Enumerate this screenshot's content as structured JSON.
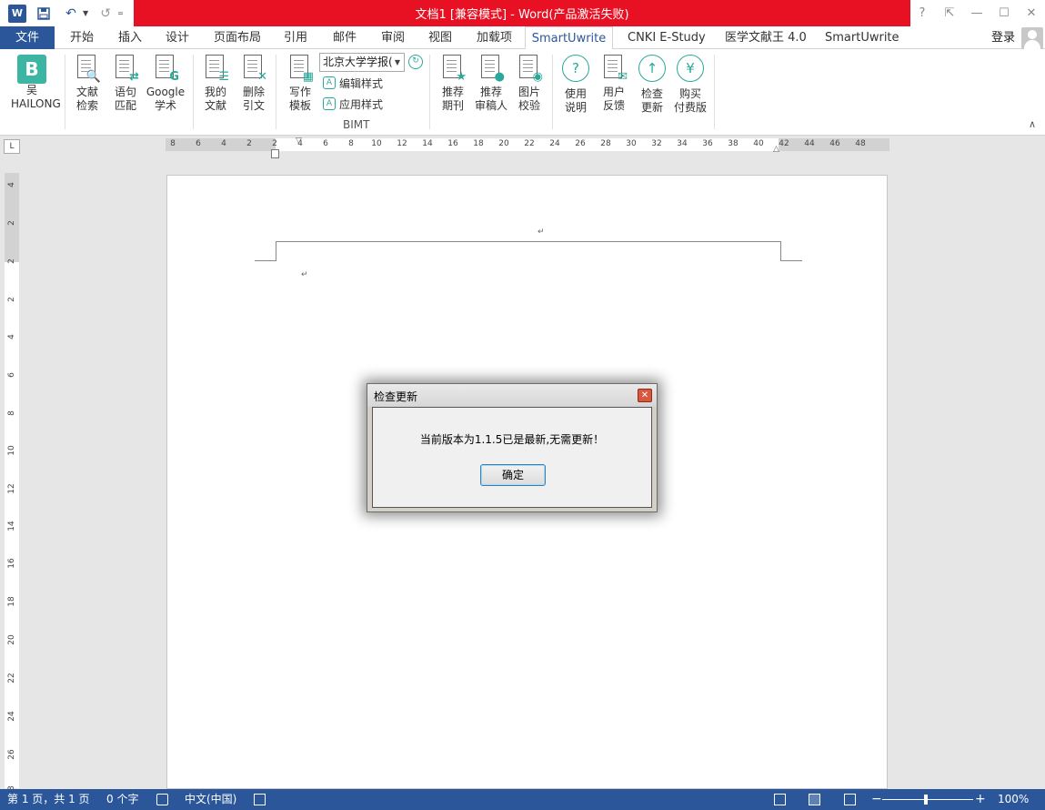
{
  "titlebar": {
    "title": "文档1 [兼容模式] - Word(产品激活失败)",
    "word_icon": "W",
    "undo_icon": "↶",
    "redo_icon": "↺",
    "customize_icon": "=",
    "help": "?",
    "restore_ribbon": "⇱",
    "minimize": "—",
    "maximize": "☐",
    "close": "✕"
  },
  "tabs": {
    "file": "文件",
    "items": [
      "开始",
      "插入",
      "设计",
      "页面布局",
      "引用",
      "邮件",
      "审阅",
      "视图",
      "加载项",
      "SmartUwrite",
      "CNKI E-Study",
      "医学文献王 4.0",
      "SmartUwrite"
    ],
    "active_index": 9,
    "login": "登录"
  },
  "ribbon": {
    "user_btn": {
      "icon_letter": "B",
      "line1": "吴",
      "line2": "HAILONG"
    },
    "buttons": [
      {
        "line1": "文献",
        "line2": "检索",
        "badge": "🔍"
      },
      {
        "line1": "语句",
        "line2": "匹配",
        "badge": "⇄"
      },
      {
        "line1": "Google",
        "line2": "学术",
        "badge": "G"
      },
      {
        "line1": "我的",
        "line2": "文献",
        "badge": "☰"
      },
      {
        "line1": "删除",
        "line2": "引文",
        "badge": "✕"
      },
      {
        "line1": "写作",
        "line2": "模板",
        "badge": "▦"
      }
    ],
    "style_select": "北京大学学报(",
    "edit_style": "编辑样式",
    "apply_style": "应用样式",
    "group_label": "BIMT",
    "right_buttons": [
      {
        "line1": "推荐",
        "line2": "期刊",
        "badge": "★"
      },
      {
        "line1": "推荐",
        "line2": "审稿人",
        "badge": "●"
      },
      {
        "line1": "图片",
        "line2": "校验",
        "badge": "◉"
      }
    ],
    "circle_buttons": [
      {
        "line1": "使用",
        "line2": "说明",
        "glyph": "?"
      },
      {
        "line1": "用户",
        "line2": "反馈",
        "glyph": "✉"
      },
      {
        "line1": "检查",
        "line2": "更新",
        "glyph": "↑"
      },
      {
        "line1": "购买",
        "line2": "付费版",
        "glyph": "¥"
      }
    ],
    "collapse": "∧"
  },
  "ruler": {
    "corner": "L",
    "h_ticks": [
      "8",
      "6",
      "4",
      "2",
      "2",
      "4",
      "6",
      "8",
      "10",
      "12",
      "14",
      "16",
      "18",
      "20",
      "22",
      "24",
      "26",
      "28",
      "30",
      "32",
      "34",
      "36",
      "38",
      "40",
      "42",
      "44",
      "46",
      "48"
    ],
    "v_ticks": [
      "4",
      "2",
      "2",
      "2",
      "4",
      "6",
      "8",
      "10",
      "12",
      "14",
      "16",
      "18",
      "20",
      "22",
      "24",
      "26",
      "28"
    ]
  },
  "document": {
    "para_mark": "↵"
  },
  "dialog": {
    "title": "检查更新",
    "message": "当前版本为1.1.5已是最新,无需更新！",
    "ok": "确定",
    "close": "✕"
  },
  "statusbar": {
    "page": "第 1 页，共 1 页",
    "words": "0 个字",
    "language": "中文(中国)",
    "zoom_minus": "−",
    "zoom_plus": "+",
    "zoom": "100%"
  }
}
